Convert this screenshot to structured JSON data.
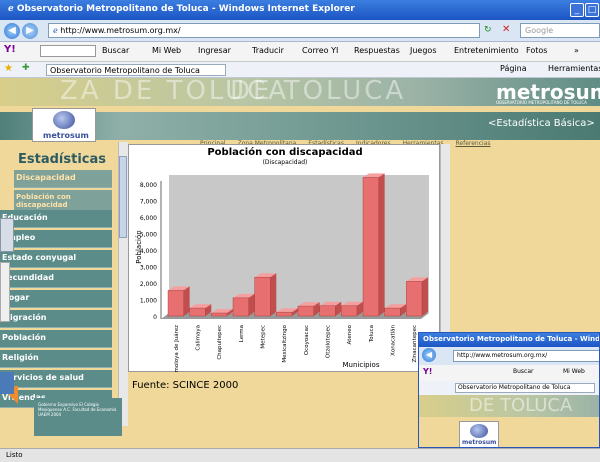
{
  "window": {
    "title": "Observatorio Metropolitano de Toluca - Windows Internet Explorer",
    "url": "http://www.metrosum.org.mx/",
    "search_placeholder": "Google",
    "status": "Listo"
  },
  "toolbar": {
    "search_label": "Buscar",
    "items": [
      "Mi Web",
      "Ingresar",
      "Traducir",
      "Correo YI",
      "Respuestas",
      "Juegos",
      "Entretenimiento",
      "Fotos"
    ],
    "more": "»"
  },
  "favorites": {
    "tab_label": "Observatorio Metropolitano de Toluca",
    "pagina_label": "Página",
    "herramientas_label": "Herramientas"
  },
  "site": {
    "banner_text": "ZA DE TOLUCA",
    "banner_text2": "DE TOLUCA",
    "brand": "metrosum",
    "brand_sub": "OBSERVATORIO METROPOLITANO DE TOLUCA",
    "logo_text": "metrosum",
    "section_link": "<Estadística Básica>",
    "nav": [
      "Principal",
      "Zona Metropolitana",
      "Estadísticas",
      "Indicadores",
      "Herramientas",
      "Referencias"
    ],
    "sidebar_title": "Estadísticas",
    "sidebar_items": [
      {
        "label": "Discapacidad",
        "sub": true
      },
      {
        "label": "Población con discapacidad",
        "sub": true
      },
      {
        "label": "Educación",
        "sub": false
      },
      {
        "label": "Empleo",
        "sub": false
      },
      {
        "label": "Estado conyugal",
        "sub": false
      },
      {
        "label": "Fecundidad",
        "sub": false
      },
      {
        "label": "Hogar",
        "sub": false
      },
      {
        "label": "Migración",
        "sub": false
      },
      {
        "label": "Población",
        "sub": false
      },
      {
        "label": "Religión",
        "sub": false
      },
      {
        "label": "Servicios de salud",
        "sub": false
      },
      {
        "label": "Viviendas",
        "sub": false
      }
    ],
    "footer_logo_text": "Gobierno Expansivo El Colegio Mexiquense A.C. Facultad de Economía UAEM 2004",
    "source": "Fuente: SCINCE 2000"
  },
  "chart_data": {
    "type": "bar",
    "title": "Población con discapacidad",
    "subtitle": "(Discapacidad)",
    "xlabel": "Municipios",
    "ylabel": "Población",
    "ylim": [
      0,
      8000
    ],
    "yticks": [
      0,
      1000,
      2000,
      3000,
      4000,
      5000,
      6000,
      7000,
      8000
    ],
    "ytick_labels": [
      "0",
      "1,000",
      "2,000",
      "3,000",
      "4,000",
      "5,000",
      "6,000",
      "7,000",
      "8,000"
    ],
    "categories": [
      "Almoloya de Juárez",
      "Calimaya",
      "Chapultepec",
      "Lerma",
      "Metepec",
      "Mexicaltzingo",
      "Ocoyoacac",
      "Otzolotepec",
      "Ateneo",
      "Toluca",
      "Xonacatlán",
      "Zinacantepec"
    ],
    "values": [
      1550,
      480,
      180,
      1100,
      2350,
      230,
      600,
      620,
      620,
      8400,
      480,
      2100
    ],
    "bar_color": "#e86f6f",
    "grid": false
  },
  "second_window": {
    "title": "Observatorio Metropolitano de Toluca - Windows",
    "url": "http://www.metrosum.org.mx/",
    "search_label": "Buscar",
    "web_label": "Mi Web",
    "tab_label": "Observatorio Metropolitano de Toluca",
    "banner_text": "DE TOLUCA",
    "logo_text": "metrosum"
  },
  "colors": {
    "titlebar": "#1c55c4",
    "sidebar_menu": "#5b8c8a",
    "page_bg": "#efd899",
    "bar": "#e86f6f"
  }
}
